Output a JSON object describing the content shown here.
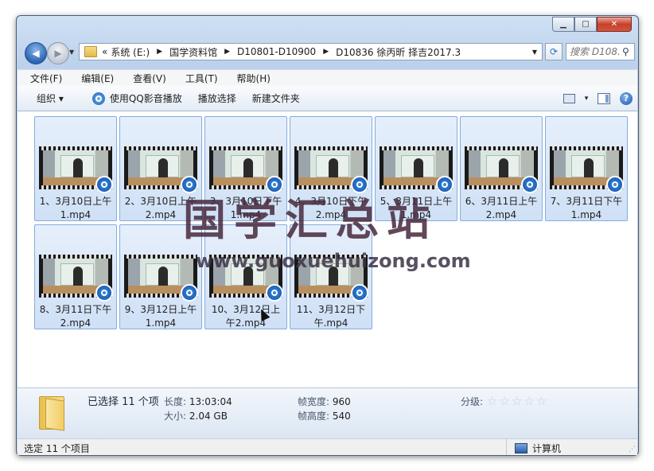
{
  "window": {
    "caption_buttons": {
      "minimize": "▁",
      "maximize": "□",
      "close": "✕"
    }
  },
  "navigation": {
    "back_icon": "◀",
    "forward_icon": "▶",
    "address_prefix": "«",
    "breadcrumb": [
      "系统 (E:)",
      "国学资料馆",
      "D10801-D10900",
      "D10836 徐丙昕 择吉2017.3"
    ],
    "search_placeholder": "搜索 D108...",
    "search_icon": "magnifier-icon",
    "refresh_icon": "⟳"
  },
  "menubar": [
    "文件(F)",
    "编辑(E)",
    "查看(V)",
    "工具(T)",
    "帮助(H)"
  ],
  "toolbar": {
    "organize": "组织 ▾",
    "play_qq": "使用QQ影音播放",
    "play_selection": "播放选择",
    "new_folder": "新建文件夹",
    "view_dropdown": "▾",
    "help_icon": "?"
  },
  "files": [
    {
      "name": "1、3月10日上午1.mp4"
    },
    {
      "name": "2、3月10日上午2.mp4"
    },
    {
      "name": "3、3月10日下午1.mp4"
    },
    {
      "name": "4、3月10日下午2.mp4"
    },
    {
      "name": "5、3月11日上午1.mp4"
    },
    {
      "name": "6、3月11日上午2.mp4"
    },
    {
      "name": "7、3月11日下午1.mp4"
    },
    {
      "name": "8、3月11日下午2.mp4"
    },
    {
      "name": "9、3月12日上午1.mp4"
    },
    {
      "name": "10、3月12日上午2.mp4"
    },
    {
      "name": "11、3月12日下午.mp4"
    }
  ],
  "details": {
    "selected": "已选择 11 个项",
    "length_label": "长度:",
    "length_value": "13:03:04",
    "size_label": "大小:",
    "size_value": "2.04 GB",
    "frame_width_label": "帧宽度:",
    "frame_width_value": "960",
    "frame_height_label": "帧高度:",
    "frame_height_value": "540",
    "rating_label": "分级:",
    "rating_stars": 0
  },
  "statusbar": {
    "left": "选定 11 个项目",
    "right": "计算机"
  },
  "watermark": {
    "title": "国学汇总站",
    "url": "www.guoxuehuizong.com"
  }
}
